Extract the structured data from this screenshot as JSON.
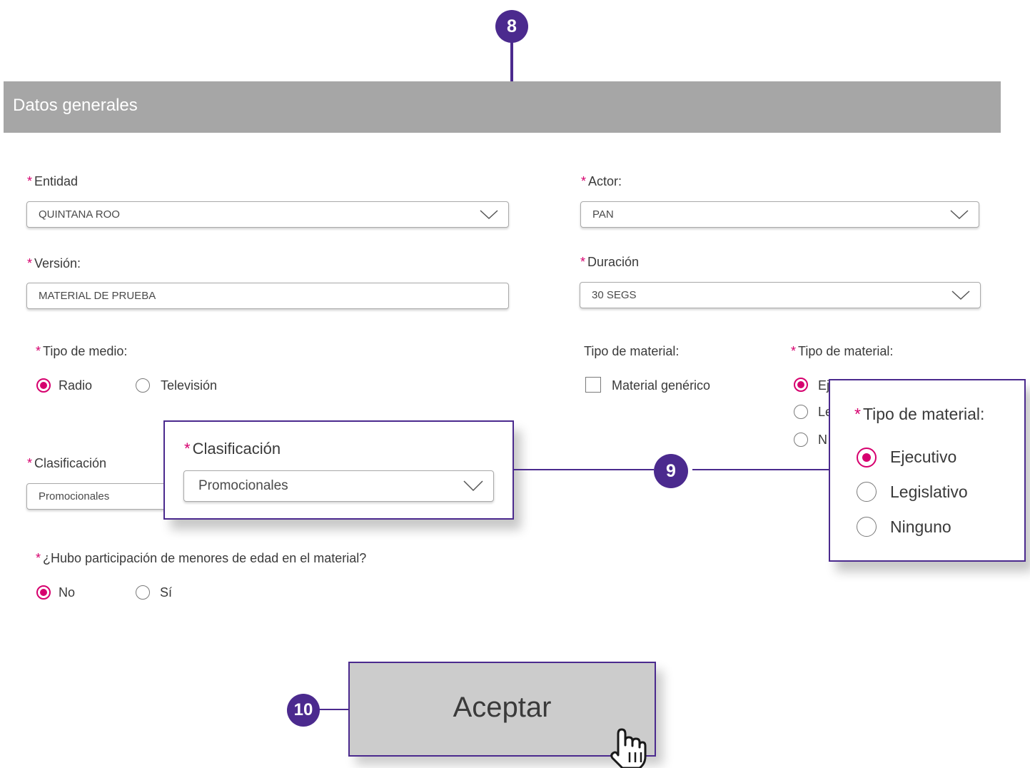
{
  "header": {
    "title": "Datos generales"
  },
  "steps": {
    "s8": "8",
    "s9": "9",
    "s10": "10"
  },
  "required_mark": "*",
  "form": {
    "entidad": {
      "label": "Entidad",
      "value": "QUINTANA ROO"
    },
    "actor": {
      "label": "Actor:",
      "value": "PAN"
    },
    "version": {
      "label": "Versión:",
      "value": "MATERIAL DE PRUEBA"
    },
    "duracion": {
      "label": "Duración",
      "value": "30 SEGS"
    },
    "tipo_medio": {
      "label": "Tipo de medio:",
      "options": [
        "Radio",
        "Televisión"
      ],
      "selected": "Radio"
    },
    "tipo_material_check": {
      "label": "Tipo de material:",
      "checkbox_label": "Material genérico",
      "checked": false
    },
    "tipo_material_radio": {
      "label": "Tipo de material:",
      "options_partial": [
        "Ej",
        "Le",
        "N"
      ]
    },
    "clasificacion": {
      "label": "Clasificación",
      "value": "Promocionales"
    },
    "menores": {
      "label": "¿Hubo participación de menores de edad en el material?",
      "options": [
        "No",
        "Sí"
      ],
      "selected": "No"
    }
  },
  "callout_clasificacion": {
    "label": "Clasificación",
    "value": "Promocionales"
  },
  "callout_tipo_material": {
    "label": "Tipo de material:",
    "options": [
      "Ejecutivo",
      "Legislativo",
      "Ninguno"
    ],
    "selected": "Ejecutivo"
  },
  "accept_button": {
    "label": "Aceptar"
  },
  "colors": {
    "accent": "#d6006e",
    "annotation": "#4b2a8e",
    "header_bg": "#a6a6a6",
    "button_bg": "#cccccc"
  },
  "icons": [
    "chevron-down-icon",
    "hand-pointer-icon"
  ]
}
